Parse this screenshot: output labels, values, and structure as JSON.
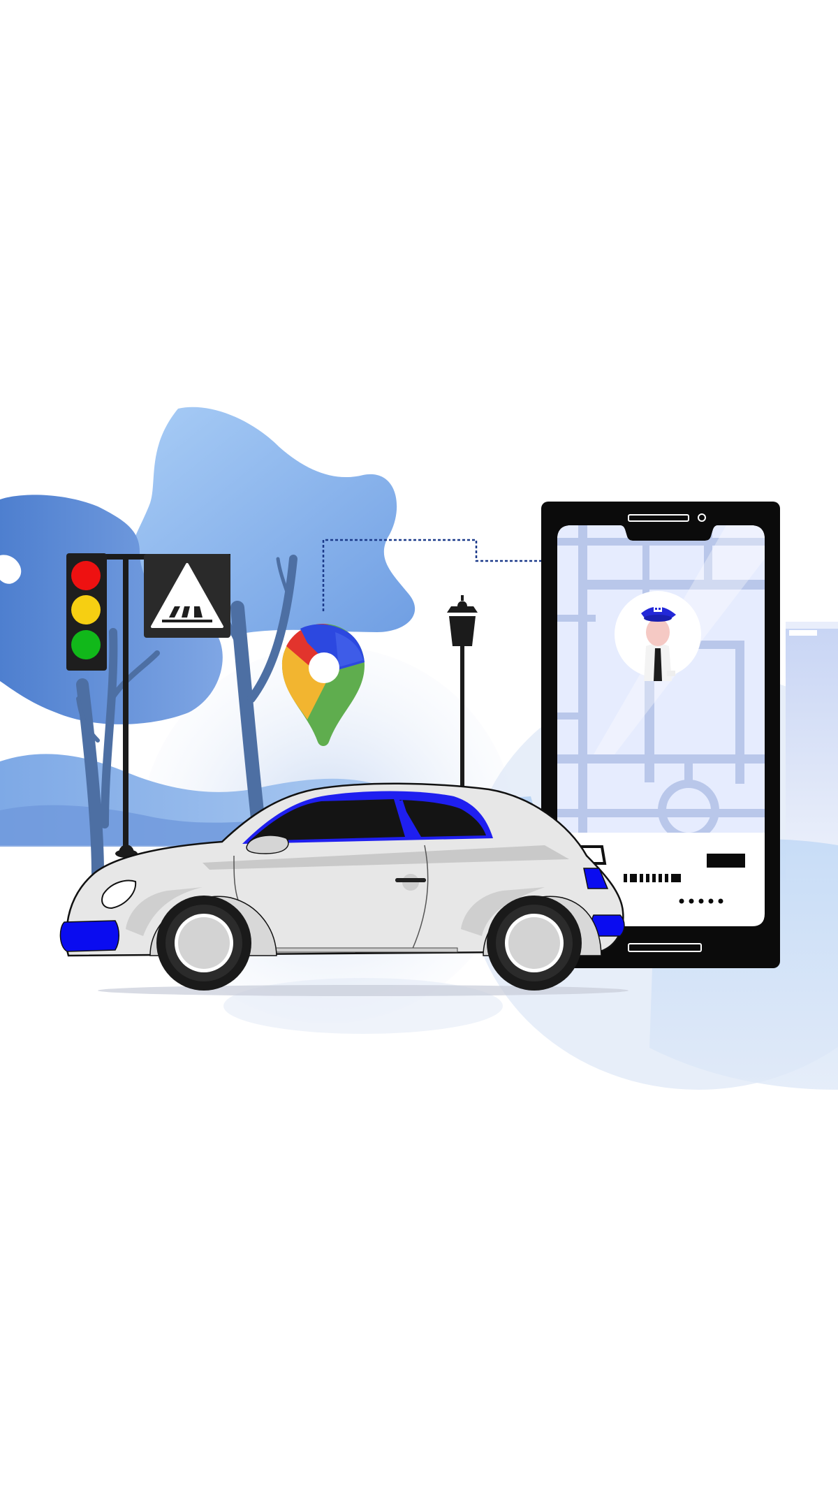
{
  "scene": {
    "subject": "taxi-booking-illustration",
    "icons": [
      "traffic-light-icon",
      "pedestrian-crossing-icon",
      "map-pin-icon",
      "street-lamp-icon",
      "smartphone-icon",
      "taxi-driver-avatar-icon",
      "car-icon",
      "tree-icon"
    ],
    "colors": {
      "accent_blue": "#1f1ff0",
      "sky_blue": "#8fb8ee",
      "deep_blue": "#5b86cf",
      "tree_trunk": "#4d6fa3",
      "traffic_red": "#ee1111",
      "traffic_yellow": "#f6cf12",
      "traffic_green": "#11b81a",
      "pin_red": "#e2342d",
      "pin_yellow": "#f2b530",
      "pin_green": "#5fad4e",
      "pin_blue": "#2c48e0",
      "car_body": "#e7e7e7",
      "phone_frame": "#0b0b0b",
      "map_bg": "#e7edff",
      "map_road": "#b9c7ea"
    }
  }
}
